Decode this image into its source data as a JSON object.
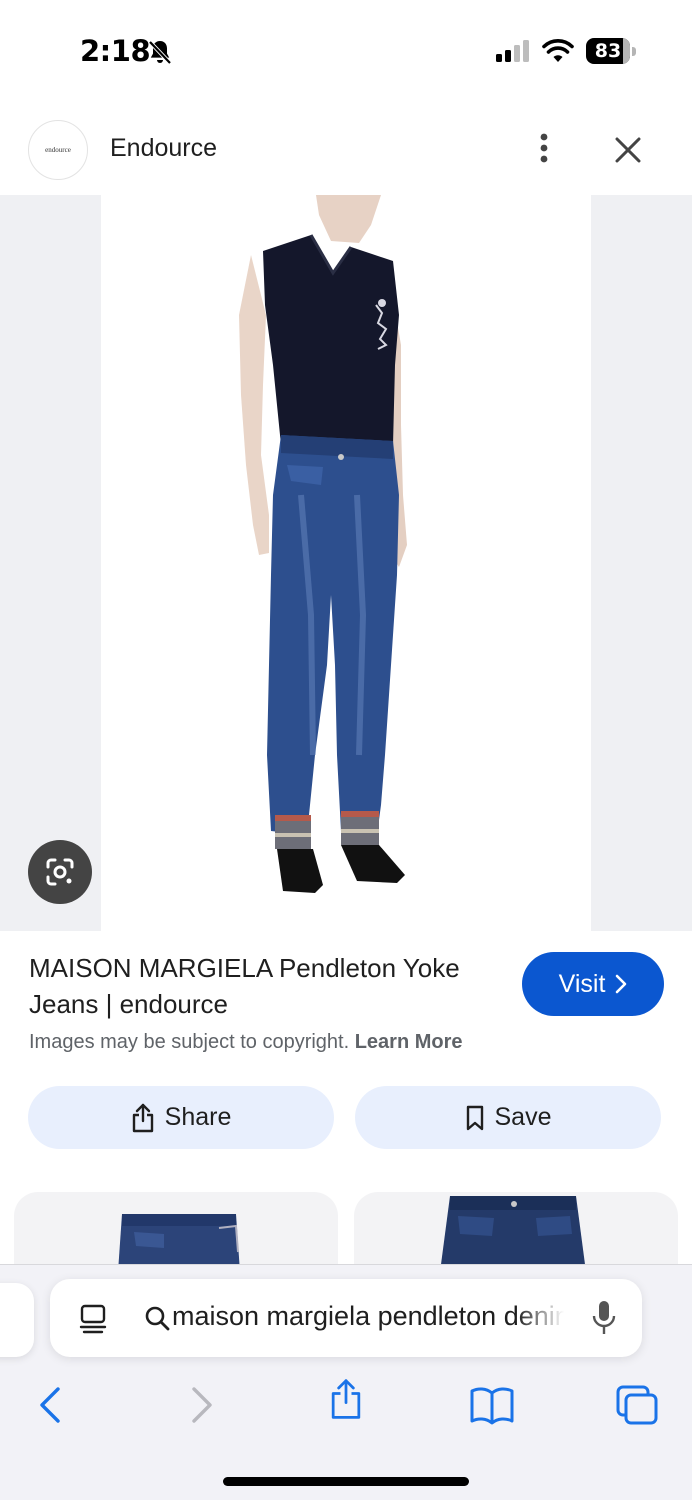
{
  "status_bar": {
    "time": "2:18",
    "battery": "83",
    "battery_level": 0.83
  },
  "header": {
    "logo_text": "endource",
    "site_name": "Endource"
  },
  "result": {
    "title": "MAISON MARGIELA Pendleton Yoke Jeans | endource",
    "visit_label": "Visit",
    "copyright_text": "Images may be subject to copyright.",
    "learn_more": "Learn More"
  },
  "actions": {
    "share_label": "Share",
    "save_label": "Save"
  },
  "browser": {
    "address_text": "maison margiela pendleton denim"
  },
  "colors": {
    "accent": "#0b57d0",
    "action_bg": "#e8effd",
    "image_backdrop": "#eff0f3"
  }
}
